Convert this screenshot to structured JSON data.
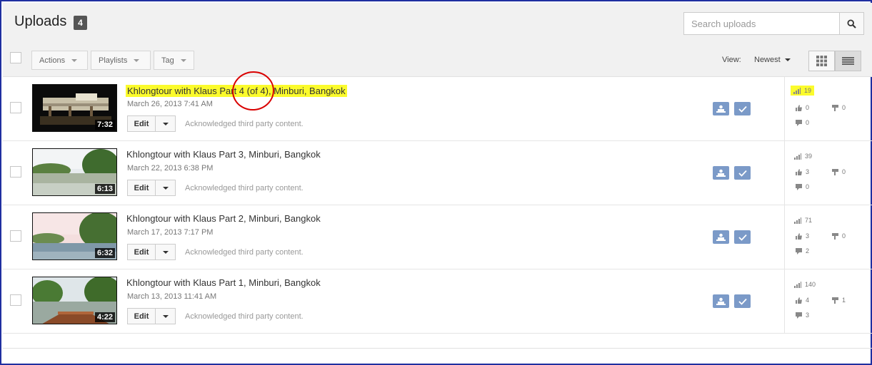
{
  "header": {
    "title": "Uploads",
    "count": "4",
    "search_placeholder": "Search uploads"
  },
  "toolbar": {
    "actions_label": "Actions",
    "playlists_label": "Playlists",
    "tag_label": "Tag",
    "view_label": "View:",
    "sort_label": "Newest"
  },
  "common": {
    "edit_label": "Edit",
    "ack_text": "Acknowledged third party content."
  },
  "videos": [
    {
      "title": "Khlongtour with Klaus Part 4 (of 4), Minburi, Bangkok",
      "date": "March 26, 2013 7:41 AM",
      "duration": "7:32",
      "views": "19",
      "likes": "0",
      "dislikes": "0",
      "comments": "0"
    },
    {
      "title": "Khlongtour with Klaus Part 3, Minburi, Bangkok",
      "date": "March 22, 2013 6:38 PM",
      "duration": "6:13",
      "views": "39",
      "likes": "3",
      "dislikes": "0",
      "comments": "0"
    },
    {
      "title": "Khlongtour with Klaus Part 2, Minburi, Bangkok",
      "date": "March 17, 2013 7:17 PM",
      "duration": "6:32",
      "views": "71",
      "likes": "3",
      "dislikes": "0",
      "comments": "2"
    },
    {
      "title": "Khlongtour with Klaus Part 1, Minburi, Bangkok",
      "date": "March 13, 2013 11:41 AM",
      "duration": "4:22",
      "views": "140",
      "likes": "4",
      "dislikes": "1",
      "comments": "3"
    }
  ],
  "colors": {
    "highlight": "#fbfb2c",
    "annotation_circle": "#d90000",
    "action_button": "#7b9ac8"
  },
  "icons": {
    "search": "search-icon",
    "grid_view": "grid-view-icon",
    "list_view": "list-view-icon",
    "views": "bar-chart-icon",
    "likes": "thumbs-up-icon",
    "dislikes": "thumbs-down-icon",
    "comments": "comment-icon"
  }
}
